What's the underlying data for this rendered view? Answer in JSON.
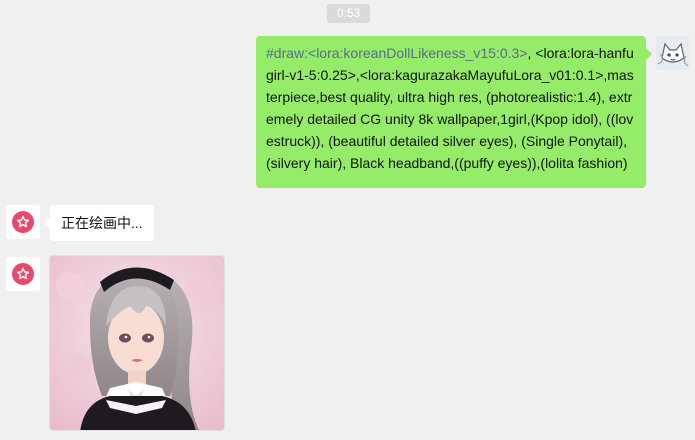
{
  "timestamp": "0:53",
  "outgoing": {
    "cmd_prefix": "#draw:<lora:koreanDollLikeness_v15:0.3>",
    "prompt_rest": ", <lora:lora-hanfugirl-v1-5:0.25>,<lora:kagurazakaMayufuLora_v01:0.1>,masterpiece,best quality, ultra high res, (photorealistic:1.4), extremely detailed CG unity 8k wallpaper,1girl,(Kpop idol), ((lovestruck)), (beautiful detailed silver eyes), (Single Ponytail),(silvery hair), Black headband,((puffy eyes)),(lolita fashion)",
    "avatar_icon": "cat-sketch-avatar"
  },
  "incoming": {
    "status_text": "正在绘画中...",
    "avatar_icon": "star-badge-icon",
    "image_subject": "generated-portrait-image"
  },
  "colors": {
    "background": "#f0f0f0",
    "outgoing_bubble": "#95ec69",
    "incoming_bubble": "#ffffff",
    "command_text": "#576b95",
    "bot_badge": "#e5496b"
  }
}
